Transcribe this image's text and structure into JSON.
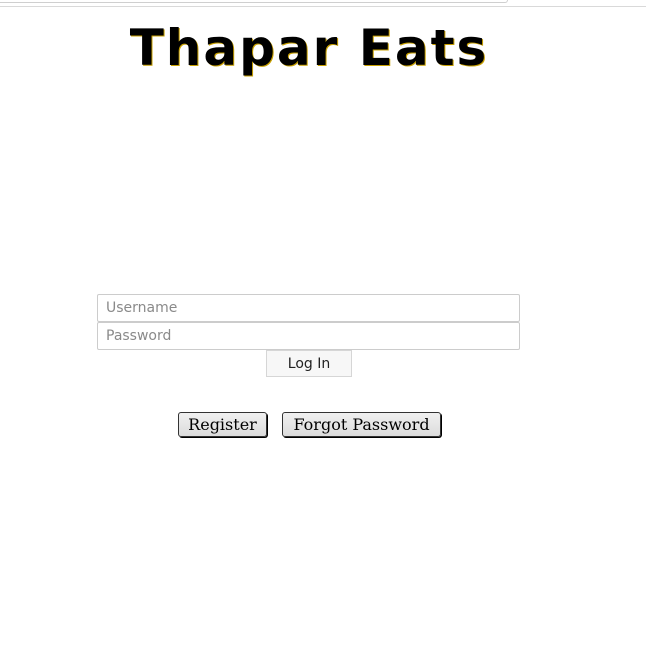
{
  "app": {
    "title": "Thapar Eats"
  },
  "login": {
    "username_placeholder": "Username",
    "username_value": "",
    "password_placeholder": "Password",
    "password_value": "",
    "login_label": "Log In"
  },
  "actions": {
    "register_label": "Register",
    "forgot_label": "Forgot Password"
  }
}
